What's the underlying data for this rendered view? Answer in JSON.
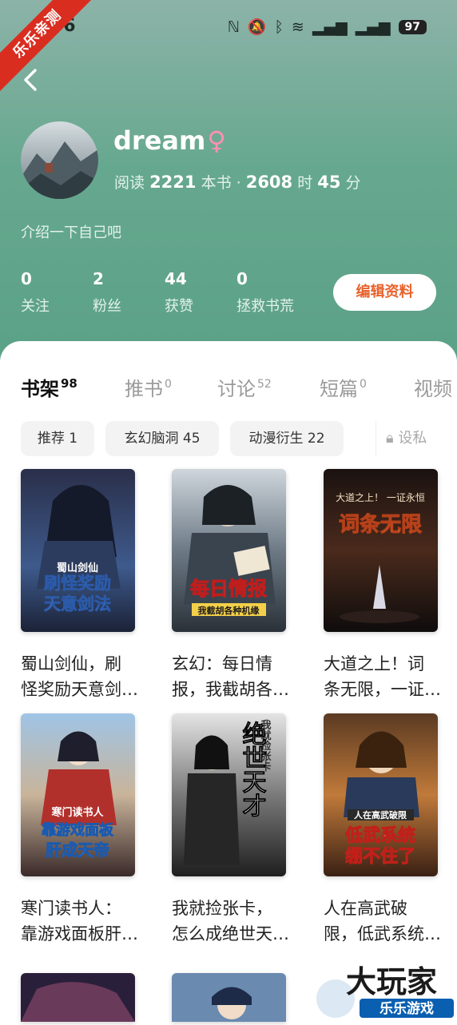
{
  "status_bar": {
    "time": "56",
    "battery": "97",
    "ribbon": "乐乐亲测"
  },
  "profile": {
    "name": "dream",
    "gender_symbol": "♀",
    "read_label": "阅读",
    "books_read": "2221",
    "books_unit": "本书 ·",
    "hours": "2608",
    "hours_unit": "时",
    "minutes": "45",
    "minutes_unit": "分",
    "intro": "介绍一下自己吧",
    "edit_label": "编辑资料"
  },
  "stats": [
    {
      "value": "0",
      "label": "关注"
    },
    {
      "value": "2",
      "label": "粉丝"
    },
    {
      "value": "44",
      "label": "获赞"
    },
    {
      "value": "0",
      "label": "拯救书荒"
    }
  ],
  "tabs": [
    {
      "label": "书架",
      "count": "98",
      "active": true
    },
    {
      "label": "推书",
      "count": "0"
    },
    {
      "label": "讨论",
      "count": "52"
    },
    {
      "label": "短篇",
      "count": "0"
    },
    {
      "label": "视频",
      "count": ""
    }
  ],
  "chips": [
    "推荐 1",
    "玄幻脑洞 45",
    "动漫衍生 22"
  ],
  "privacy_label": "设私",
  "books": [
    {
      "title_line1": "蜀山剑仙，刷",
      "title_line2": "怪奖励天意剑…",
      "cover_text": "刷怪奖励",
      "cover_text2": "天意剑法",
      "cover_small": "蜀山剑仙"
    },
    {
      "title_line1": "玄幻：每日情",
      "title_line2": "报，我截胡各…",
      "cover_text": "每日情报",
      "cover_text2": "",
      "cover_small": "我截胡各种机缘"
    },
    {
      "title_line1": "大道之上！词",
      "title_line2": "条无限，一证…",
      "cover_text": "词条无限",
      "cover_text2": "",
      "cover_small": "大道之上！ 一证永恒"
    },
    {
      "title_line1": "寒门读书人：",
      "title_line2": "靠游戏面板肝…",
      "cover_text": "靠游戏面板",
      "cover_text2": "肝成天帝",
      "cover_small": "寒门读书人"
    },
    {
      "title_line1": "我就捡张卡，",
      "title_line2": "怎么成绝世天…",
      "cover_text": "绝世天才",
      "cover_text2": "",
      "cover_small": "我就捡张卡"
    },
    {
      "title_line1": "人在高武破",
      "title_line2": "限，低武系统…",
      "cover_text": "低武系统",
      "cover_text2": "绷不住了",
      "cover_small": "人在高武破限"
    }
  ],
  "watermark": "大玩家 乐乐游戏",
  "colors": {
    "accent": "#e8622c",
    "hero": "#5aa187",
    "gender": "#ff8fb3"
  }
}
